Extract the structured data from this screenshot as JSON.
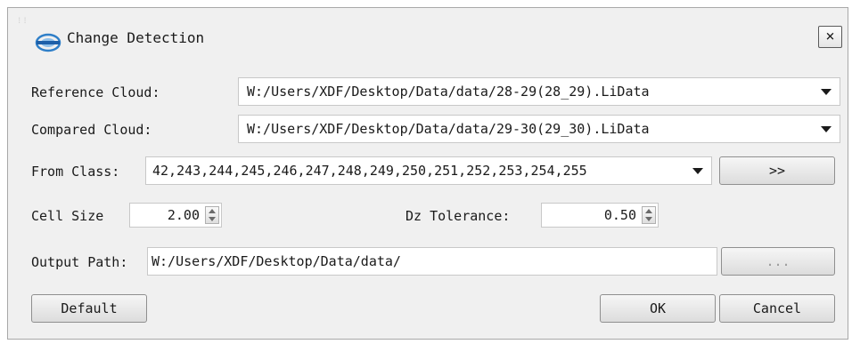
{
  "dialog": {
    "title": "Change Detection",
    "close_label": "×",
    "logo_icon": "lidata-logo-icon"
  },
  "reference_cloud": {
    "label": "Reference Cloud:",
    "value": "W:/Users/XDF/Desktop/Data/data/28-29(28_29).LiData"
  },
  "compared_cloud": {
    "label": "Compared Cloud:",
    "value": "W:/Users/XDF/Desktop/Data/data/29-30(29_30).LiData"
  },
  "from_class": {
    "label": "From Class:",
    "value": "42,243,244,245,246,247,248,249,250,251,252,253,254,255",
    "more_button_label": ">>"
  },
  "cell_size": {
    "label": "Cell Size",
    "value": "2.00"
  },
  "dz_tolerance": {
    "label": "Dz Tolerance:",
    "value": "0.50"
  },
  "output_path": {
    "label": "Output Path:",
    "value": "W:/Users/XDF/Desktop/Data/data/",
    "browse_label": "..."
  },
  "buttons": {
    "default_label": "Default",
    "ok_label": "OK",
    "cancel_label": "Cancel"
  }
}
